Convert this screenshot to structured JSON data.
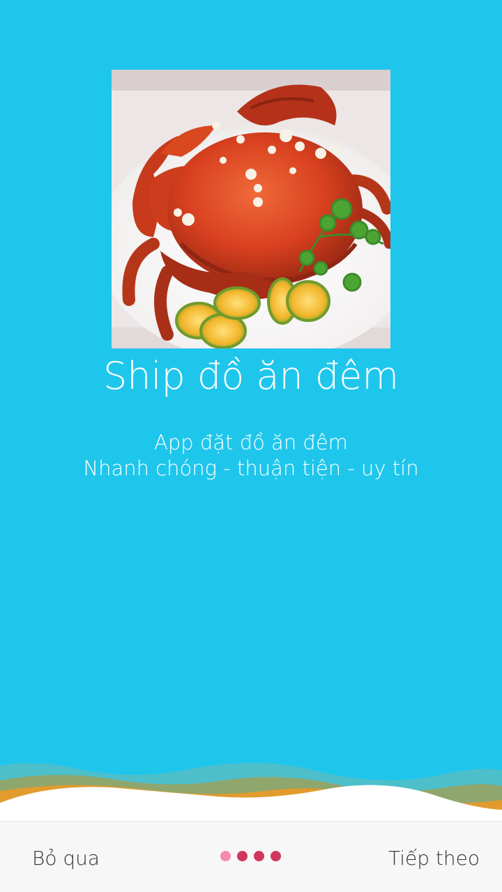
{
  "colors": {
    "background": "#1FC6EC",
    "bottom_bar": "#F7F7F7",
    "dot_active": "#F48AAE",
    "dot_inactive": "#D0365F",
    "wave_teal": "#4DBFCB",
    "wave_green": "#8FA66C",
    "wave_orange": "#E19B2E",
    "wave_white": "#FFFFFF"
  },
  "onboarding": {
    "image": "crab-dish-image",
    "title": "Ship đồ ăn đêm",
    "subtitle_line1": "App đặt đồ ăn đêm",
    "subtitle_line2": "Nhanh chóng - thuận tiện - uy tín"
  },
  "footer": {
    "skip_label": "Bỏ qua",
    "next_label": "Tiếp theo",
    "page_indicator": {
      "total": 4,
      "current": 1
    }
  }
}
